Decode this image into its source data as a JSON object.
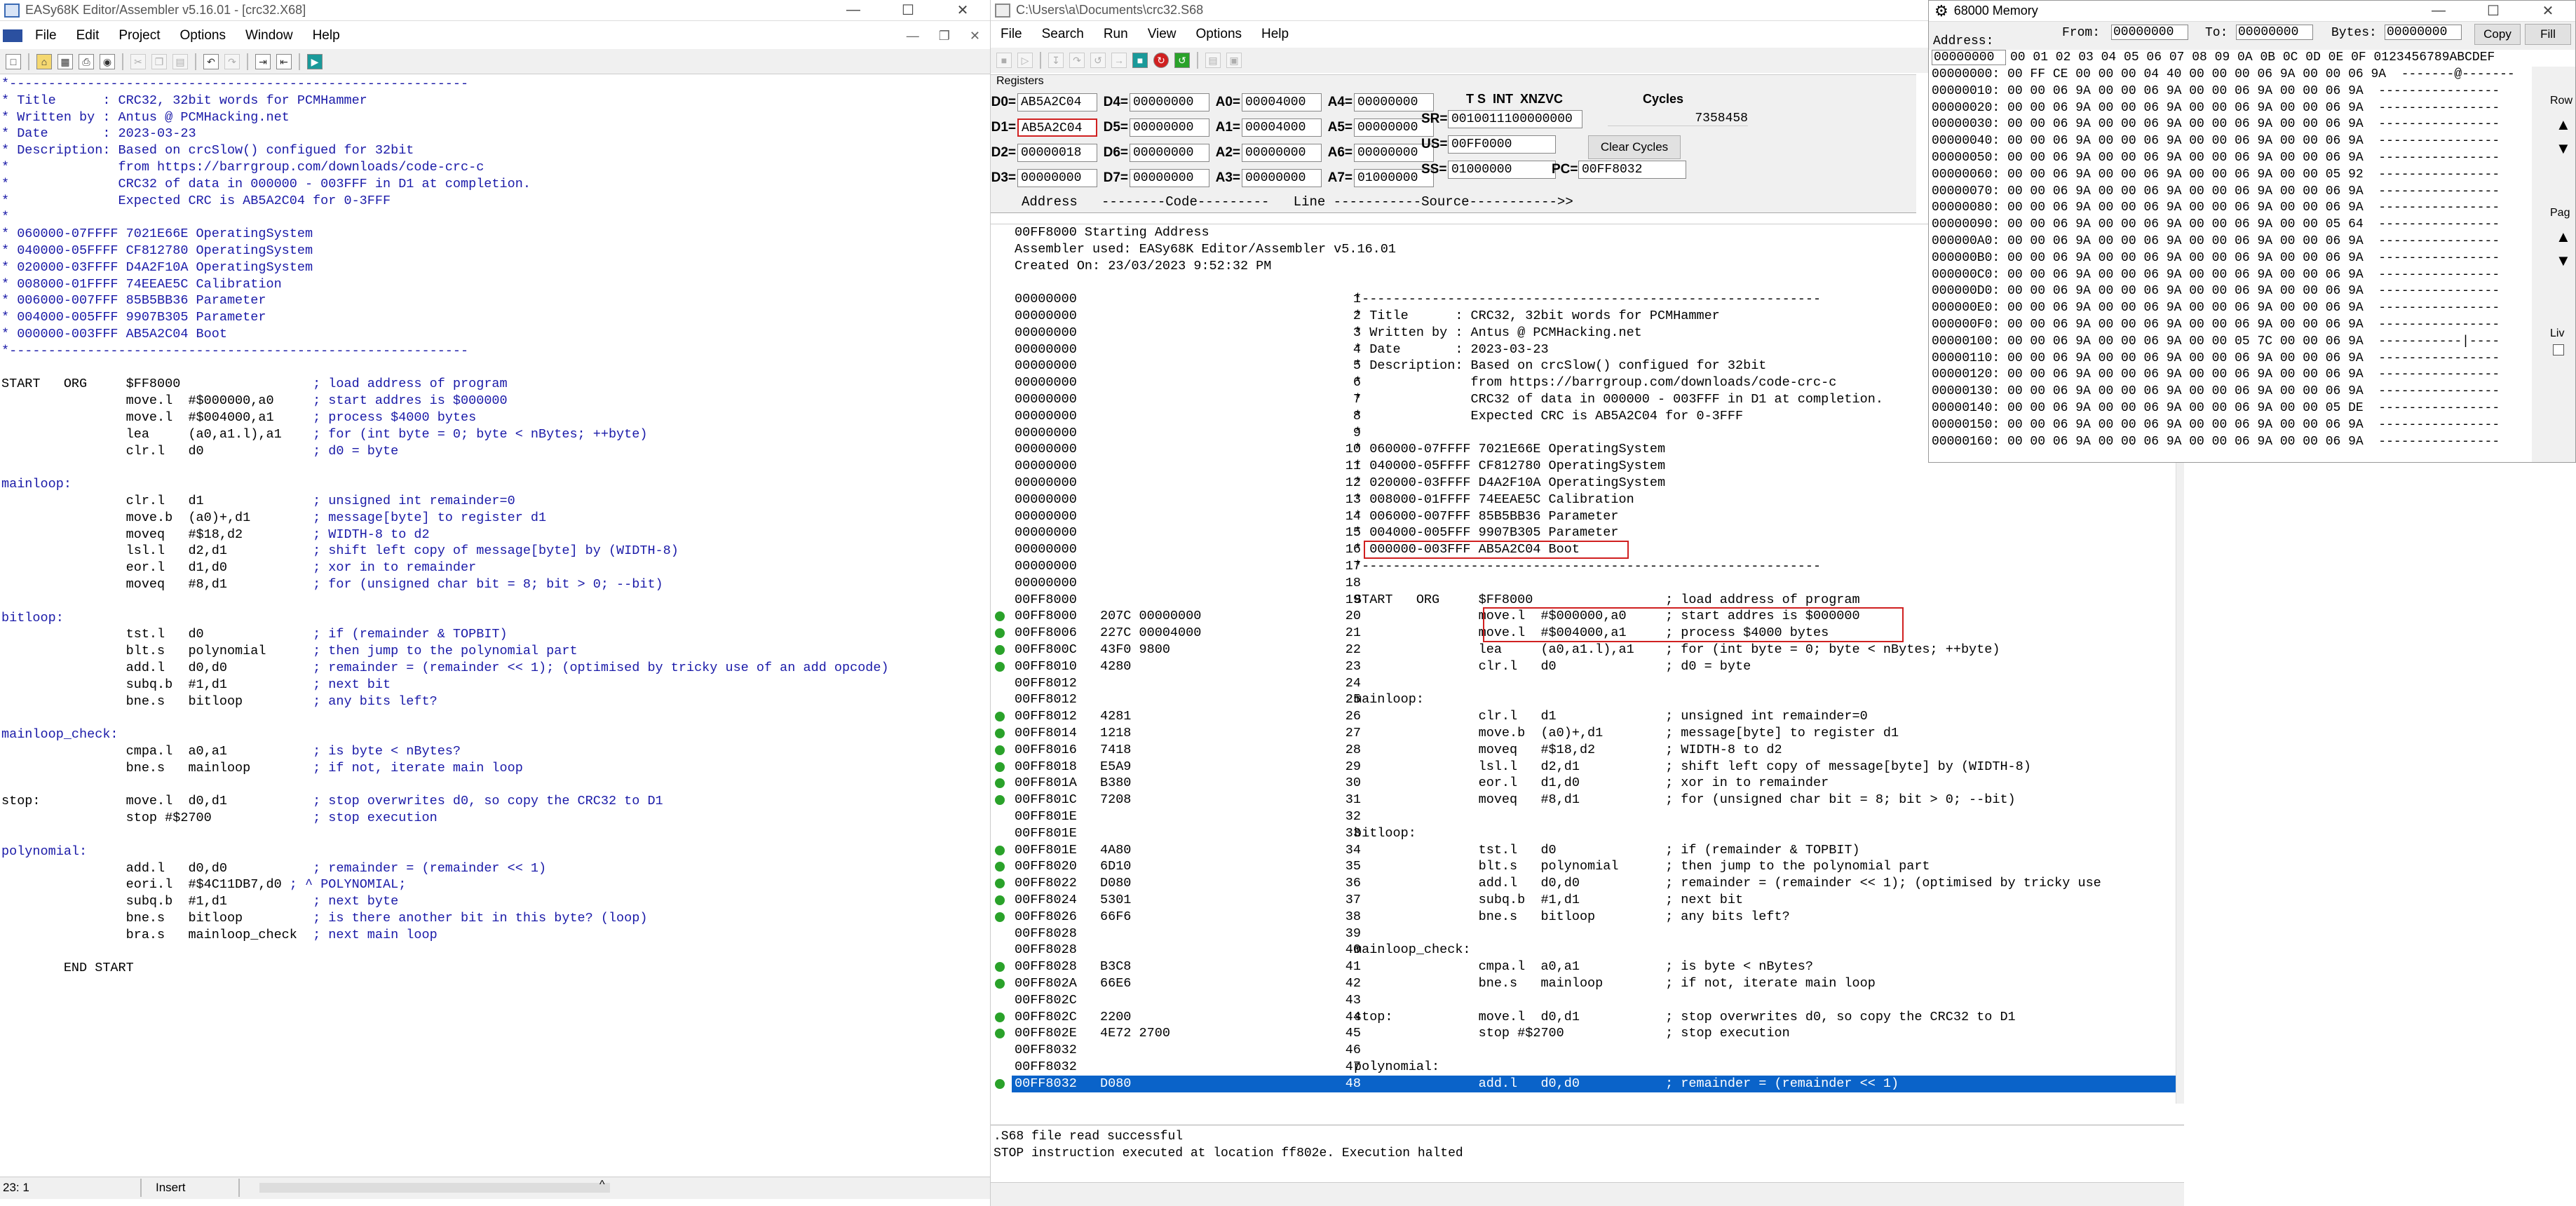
{
  "editor": {
    "title": "EASy68K Editor/Assembler v5.16.01 - [crc32.X68]",
    "menu": [
      "File",
      "Edit",
      "Project",
      "Options",
      "Window",
      "Help"
    ],
    "status": {
      "pos": "23: 1",
      "mode": "Insert"
    },
    "code": [
      {
        "t": "*-----------------------------------------------------------",
        "c": "blue"
      },
      {
        "t": "* Title      : CRC32, 32bit words for PCMHammer",
        "c": "blue"
      },
      {
        "t": "* Written by : Antus @ PCMHacking.net",
        "c": "blue"
      },
      {
        "t": "* Date       : 2023-03-23",
        "c": "blue"
      },
      {
        "t": "* Description: Based on crcSlow() configued for 32bit",
        "c": "blue"
      },
      {
        "t": "*              from https://barrgroup.com/downloads/code-crc-c",
        "c": "blue"
      },
      {
        "t": "*              CRC32 of data in 000000 - 003FFF in D1 at completion.",
        "c": "blue"
      },
      {
        "t": "*              Expected CRC is AB5A2C04 for 0-3FFF",
        "c": "blue"
      },
      {
        "t": "*",
        "c": "blue"
      },
      {
        "t": "* 060000-07FFFF 7021E66E OperatingSystem",
        "c": "blue"
      },
      {
        "t": "* 040000-05FFFF CF812780 OperatingSystem",
        "c": "blue"
      },
      {
        "t": "* 020000-03FFFF D4A2F10A OperatingSystem",
        "c": "blue"
      },
      {
        "t": "* 008000-01FFFF 74EEAE5C Calibration",
        "c": "blue"
      },
      {
        "t": "* 006000-007FFF 85B5BB36 Parameter",
        "c": "blue"
      },
      {
        "t": "* 004000-005FFF 9907B305 Parameter",
        "c": "blue"
      },
      {
        "t": "* 000000-003FFF AB5A2C04 Boot",
        "c": "blue"
      },
      {
        "t": "*-----------------------------------------------------------",
        "c": "blue"
      },
      {
        "t": "",
        "c": ""
      },
      {
        "t": "START   ORG     $FF8000                 ; load address of program",
        "c": "mix"
      },
      {
        "t": "                move.l  #$000000,a0     ; start addres is $000000",
        "c": "mix"
      },
      {
        "t": "                move.l  #$004000,a1     ; process $4000 bytes",
        "c": "mix"
      },
      {
        "t": "                lea     (a0,a1.l),a1    ; for (int byte = 0; byte < nBytes; ++byte)",
        "c": "mix"
      },
      {
        "t": "                clr.l   d0              ; d0 = byte",
        "c": "mix"
      },
      {
        "t": "",
        "c": ""
      },
      {
        "t": "mainloop:",
        "c": "blue"
      },
      {
        "t": "                clr.l   d1              ; unsigned int remainder=0",
        "c": "mix"
      },
      {
        "t": "                move.b  (a0)+,d1        ; message[byte] to register d1",
        "c": "mix"
      },
      {
        "t": "                moveq   #$18,d2         ; WIDTH-8 to d2",
        "c": "mix"
      },
      {
        "t": "                lsl.l   d2,d1           ; shift left copy of message[byte] by (WIDTH-8)",
        "c": "mix"
      },
      {
        "t": "                eor.l   d1,d0           ; xor in to remainder",
        "c": "mix"
      },
      {
        "t": "                moveq   #8,d1           ; for (unsigned char bit = 8; bit > 0; --bit)",
        "c": "mix"
      },
      {
        "t": "",
        "c": ""
      },
      {
        "t": "bitloop:",
        "c": "blue"
      },
      {
        "t": "                tst.l   d0              ; if (remainder & TOPBIT)",
        "c": "mix"
      },
      {
        "t": "                blt.s   polynomial      ; then jump to the polynomial part",
        "c": "mix"
      },
      {
        "t": "                add.l   d0,d0           ; remainder = (remainder << 1); (optimised by tricky use of an add opcode)",
        "c": "mix"
      },
      {
        "t": "                subq.b  #1,d1           ; next bit",
        "c": "mix"
      },
      {
        "t": "                bne.s   bitloop         ; any bits left?",
        "c": "mix"
      },
      {
        "t": "",
        "c": ""
      },
      {
        "t": "mainloop_check:",
        "c": "blue"
      },
      {
        "t": "                cmpa.l  a0,a1           ; is byte < nBytes?",
        "c": "mix"
      },
      {
        "t": "                bne.s   mainloop        ; if not, iterate main loop",
        "c": "mix"
      },
      {
        "t": "",
        "c": ""
      },
      {
        "t": "stop:           move.l  d0,d1           ; stop overwrites d0, so copy the CRC32 to D1",
        "c": "mix"
      },
      {
        "t": "                stop #$2700             ; stop execution",
        "c": "mix"
      },
      {
        "t": "",
        "c": ""
      },
      {
        "t": "polynomial:",
        "c": "blue"
      },
      {
        "t": "                add.l   d0,d0           ; remainder = (remainder << 1)",
        "c": "mix"
      },
      {
        "t": "                eori.l  #$4C11DB7,d0 ; ^ POLYNOMIAL;",
        "c": "mix"
      },
      {
        "t": "                subq.b  #1,d1           ; next byte",
        "c": "mix"
      },
      {
        "t": "                bne.s   bitloop         ; is there another bit in this byte? (loop)",
        "c": "mix"
      },
      {
        "t": "                bra.s   mainloop_check  ; next main loop",
        "c": "mix"
      },
      {
        "t": "",
        "c": ""
      },
      {
        "t": "        END START",
        "c": ""
      }
    ]
  },
  "sim": {
    "title": "C:\\Users\\a\\Documents\\crc32.S68",
    "menu": [
      "File",
      "Search",
      "Run",
      "View",
      "Options",
      "Help"
    ],
    "registers_label": "Registers",
    "registers": [
      {
        "n": "D0=",
        "v": "AB5A2C04",
        "hl": false
      },
      {
        "n": "D4=",
        "v": "00000000",
        "hl": false
      },
      {
        "n": "A0=",
        "v": "00004000",
        "hl": false
      },
      {
        "n": "A4=",
        "v": "00000000",
        "hl": false
      },
      {
        "n": "D1=",
        "v": "AB5A2C04",
        "hl": true
      },
      {
        "n": "D5=",
        "v": "00000000",
        "hl": false
      },
      {
        "n": "A1=",
        "v": "00004000",
        "hl": false
      },
      {
        "n": "A5=",
        "v": "00000000",
        "hl": false
      },
      {
        "n": "D2=",
        "v": "00000018",
        "hl": false
      },
      {
        "n": "D6=",
        "v": "00000000",
        "hl": false
      },
      {
        "n": "A2=",
        "v": "00000000",
        "hl": false
      },
      {
        "n": "A6=",
        "v": "00000000",
        "hl": false
      },
      {
        "n": "D3=",
        "v": "00000000",
        "hl": false
      },
      {
        "n": "D7=",
        "v": "00000000",
        "hl": false
      },
      {
        "n": "A3=",
        "v": "00000000",
        "hl": false
      },
      {
        "n": "A7=",
        "v": "01000000",
        "hl": false
      }
    ],
    "sr_header": "T S  INT  XNZVC",
    "sr": {
      "n": "SR=",
      "v": "0010011100000000"
    },
    "us": {
      "n": "US=",
      "v": "00FF0000"
    },
    "ss": {
      "n": "SS=",
      "v": "01000000"
    },
    "pc": {
      "n": "PC=",
      "v": "00FF8032"
    },
    "cycles_label": "Cycles",
    "cycles": "7358458",
    "clear_cycles": "Clear Cycles",
    "list_header": "Address   --------Code---------   Line -----------Source----------->>",
    "list_preamble": [
      "00FF8000 Starting Address",
      "Assembler used: EASy68K Editor/Assembler v5.16.01",
      "Created On: 23/03/2023 9:52:32 PM"
    ],
    "rows": [
      {
        "a": "00000000",
        "c": "",
        "n": "1",
        "s": "*-----------------------------------------------------------",
        "d": false
      },
      {
        "a": "00000000",
        "c": "",
        "n": "2",
        "s": "* Title      : CRC32, 32bit words for PCMHammer",
        "d": false
      },
      {
        "a": "00000000",
        "c": "",
        "n": "3",
        "s": "* Written by : Antus @ PCMHacking.net",
        "d": false
      },
      {
        "a": "00000000",
        "c": "",
        "n": "4",
        "s": "* Date       : 2023-03-23",
        "d": false
      },
      {
        "a": "00000000",
        "c": "",
        "n": "5",
        "s": "* Description: Based on crcSlow() configued for 32bit",
        "d": false
      },
      {
        "a": "00000000",
        "c": "",
        "n": "6",
        "s": "*              from https://barrgroup.com/downloads/code-crc-c",
        "d": false
      },
      {
        "a": "00000000",
        "c": "",
        "n": "7",
        "s": "*              CRC32 of data in 000000 - 003FFF in D1 at completion.",
        "d": false
      },
      {
        "a": "00000000",
        "c": "",
        "n": "8",
        "s": "*              Expected CRC is AB5A2C04 for 0-3FFF",
        "d": false
      },
      {
        "a": "00000000",
        "c": "",
        "n": "9",
        "s": "*",
        "d": false
      },
      {
        "a": "00000000",
        "c": "",
        "n": "10",
        "s": "* 060000-07FFFF 7021E66E OperatingSystem",
        "d": false
      },
      {
        "a": "00000000",
        "c": "",
        "n": "11",
        "s": "* 040000-05FFFF CF812780 OperatingSystem",
        "d": false
      },
      {
        "a": "00000000",
        "c": "",
        "n": "12",
        "s": "* 020000-03FFFF D4A2F10A OperatingSystem",
        "d": false
      },
      {
        "a": "00000000",
        "c": "",
        "n": "13",
        "s": "* 008000-01FFFF 74EEAE5C Calibration",
        "d": false
      },
      {
        "a": "00000000",
        "c": "",
        "n": "14",
        "s": "* 006000-007FFF 85B5BB36 Parameter",
        "d": false
      },
      {
        "a": "00000000",
        "c": "",
        "n": "15",
        "s": "* 004000-005FFF 9907B305 Parameter",
        "d": false
      },
      {
        "a": "00000000",
        "c": "",
        "n": "16",
        "s": "* 000000-003FFF AB5A2C04 Boot",
        "d": false
      },
      {
        "a": "00000000",
        "c": "",
        "n": "17",
        "s": "*-----------------------------------------------------------",
        "d": false
      },
      {
        "a": "00000000",
        "c": "",
        "n": "18",
        "s": "",
        "d": false
      },
      {
        "a": "00FF8000",
        "c": "",
        "n": "19",
        "s": "START   ORG     $FF8000                 ; load address of program",
        "d": false
      },
      {
        "a": "00FF8000",
        "c": "207C 00000000",
        "n": "20",
        "s": "                move.l  #$000000,a0     ; start addres is $000000",
        "d": true
      },
      {
        "a": "00FF8006",
        "c": "227C 00004000",
        "n": "21",
        "s": "                move.l  #$004000,a1     ; process $4000 bytes",
        "d": true
      },
      {
        "a": "00FF800C",
        "c": "43F0 9800",
        "n": "22",
        "s": "                lea     (a0,a1.l),a1    ; for (int byte = 0; byte < nBytes; ++byte)",
        "d": true
      },
      {
        "a": "00FF8010",
        "c": "4280",
        "n": "23",
        "s": "                clr.l   d0              ; d0 = byte",
        "d": true
      },
      {
        "a": "00FF8012",
        "c": "",
        "n": "24",
        "s": "",
        "d": false
      },
      {
        "a": "00FF8012",
        "c": "",
        "n": "25",
        "s": "mainloop:",
        "d": false
      },
      {
        "a": "00FF8012",
        "c": "4281",
        "n": "26",
        "s": "                clr.l   d1              ; unsigned int remainder=0",
        "d": true
      },
      {
        "a": "00FF8014",
        "c": "1218",
        "n": "27",
        "s": "                move.b  (a0)+,d1        ; message[byte] to register d1",
        "d": true
      },
      {
        "a": "00FF8016",
        "c": "7418",
        "n": "28",
        "s": "                moveq   #$18,d2         ; WIDTH-8 to d2",
        "d": true
      },
      {
        "a": "00FF8018",
        "c": "E5A9",
        "n": "29",
        "s": "                lsl.l   d2,d1           ; shift left copy of message[byte] by (WIDTH-8)",
        "d": true
      },
      {
        "a": "00FF801A",
        "c": "B380",
        "n": "30",
        "s": "                eor.l   d1,d0           ; xor in to remainder",
        "d": true
      },
      {
        "a": "00FF801C",
        "c": "7208",
        "n": "31",
        "s": "                moveq   #8,d1           ; for (unsigned char bit = 8; bit > 0; --bit)",
        "d": true
      },
      {
        "a": "00FF801E",
        "c": "",
        "n": "32",
        "s": "",
        "d": false
      },
      {
        "a": "00FF801E",
        "c": "",
        "n": "33",
        "s": "bitloop:",
        "d": false
      },
      {
        "a": "00FF801E",
        "c": "4A80",
        "n": "34",
        "s": "                tst.l   d0              ; if (remainder & TOPBIT)",
        "d": true
      },
      {
        "a": "00FF8020",
        "c": "6D10",
        "n": "35",
        "s": "                blt.s   polynomial      ; then jump to the polynomial part",
        "d": true
      },
      {
        "a": "00FF8022",
        "c": "D080",
        "n": "36",
        "s": "                add.l   d0,d0           ; remainder = (remainder << 1); (optimised by tricky use",
        "d": true
      },
      {
        "a": "00FF8024",
        "c": "5301",
        "n": "37",
        "s": "                subq.b  #1,d1           ; next bit",
        "d": true
      },
      {
        "a": "00FF8026",
        "c": "66F6",
        "n": "38",
        "s": "                bne.s   bitloop         ; any bits left?",
        "d": true
      },
      {
        "a": "00FF8028",
        "c": "",
        "n": "39",
        "s": "",
        "d": false
      },
      {
        "a": "00FF8028",
        "c": "",
        "n": "40",
        "s": "mainloop_check:",
        "d": false
      },
      {
        "a": "00FF8028",
        "c": "B3C8",
        "n": "41",
        "s": "                cmpa.l  a0,a1           ; is byte < nBytes?",
        "d": true
      },
      {
        "a": "00FF802A",
        "c": "66E6",
        "n": "42",
        "s": "                bne.s   mainloop        ; if not, iterate main loop",
        "d": true
      },
      {
        "a": "00FF802C",
        "c": "",
        "n": "43",
        "s": "",
        "d": false
      },
      {
        "a": "00FF802C",
        "c": "2200",
        "n": "44",
        "s": "stop:           move.l  d0,d1           ; stop overwrites d0, so copy the CRC32 to D1",
        "d": true
      },
      {
        "a": "00FF802E",
        "c": "4E72 2700",
        "n": "45",
        "s": "                stop #$2700             ; stop execution",
        "d": true
      },
      {
        "a": "00FF8032",
        "c": "",
        "n": "46",
        "s": "",
        "d": false
      },
      {
        "a": "00FF8032",
        "c": "",
        "n": "47",
        "s": "polynomial:",
        "d": false
      },
      {
        "a": "00FF8032",
        "c": "D080",
        "n": "48",
        "s": "                add.l   d0,d0           ; remainder = (remainder << 1)",
        "d": true
      }
    ],
    "messages": [
      ".S68 file read successful",
      "STOP instruction executed at location ff802e. Execution halted"
    ]
  },
  "memory": {
    "title": "68000 Memory",
    "address_label": "Address:",
    "address_value": "00000000",
    "from_label": "From:",
    "from_value": "00000000",
    "to_label": "To:",
    "to_value": "00000000",
    "bytes_label": "Bytes:",
    "bytes_value": "00000000",
    "copy_btn": "Copy",
    "fill_btn": "Fill",
    "side_labels": [
      "Row",
      "Pag",
      "Liv"
    ],
    "header": "00 01 02 03 04 05 06 07 08 09 0A 0B 0C 0D 0E 0F 0123456789ABCDEF",
    "rows": [
      "00000000: 00 FF CE 00 00 00 04 40 00 00 00 06 9A 00 00 06 9A  -------@-------",
      "00000010: 00 00 06 9A 00 00 06 9A 00 00 06 9A 00 00 06 9A  ----------------",
      "00000020: 00 00 06 9A 00 00 06 9A 00 00 06 9A 00 00 06 9A  ----------------",
      "00000030: 00 00 06 9A 00 00 06 9A 00 00 06 9A 00 00 06 9A  ----------------",
      "00000040: 00 00 06 9A 00 00 06 9A 00 00 06 9A 00 00 06 9A  ----------------",
      "00000050: 00 00 06 9A 00 00 06 9A 00 00 06 9A 00 00 06 9A  ----------------",
      "00000060: 00 00 06 9A 00 00 06 9A 00 00 06 9A 00 00 05 92  ----------------",
      "00000070: 00 00 06 9A 00 00 06 9A 00 00 06 9A 00 00 06 9A  ----------------",
      "00000080: 00 00 06 9A 00 00 06 9A 00 00 06 9A 00 00 06 9A  ----------------",
      "00000090: 00 00 06 9A 00 00 06 9A 00 00 06 9A 00 00 05 64  ----------------",
      "000000A0: 00 00 06 9A 00 00 06 9A 00 00 06 9A 00 00 06 9A  ----------------",
      "000000B0: 00 00 06 9A 00 00 06 9A 00 00 06 9A 00 00 06 9A  ----------------",
      "000000C0: 00 00 06 9A 00 00 06 9A 00 00 06 9A 00 00 06 9A  ----------------",
      "000000D0: 00 00 06 9A 00 00 06 9A 00 00 06 9A 00 00 06 9A  ----------------",
      "000000E0: 00 00 06 9A 00 00 06 9A 00 00 06 9A 00 00 06 9A  ----------------",
      "000000F0: 00 00 06 9A 00 00 06 9A 00 00 06 9A 00 00 06 9A  ----------------",
      "00000100: 00 00 06 9A 00 00 06 9A 00 00 05 7C 00 00 06 9A  -----------|----",
      "00000110: 00 00 06 9A 00 00 06 9A 00 00 06 9A 00 00 06 9A  ----------------",
      "00000120: 00 00 06 9A 00 00 06 9A 00 00 06 9A 00 00 06 9A  ----------------",
      "00000130: 00 00 06 9A 00 00 06 9A 00 00 06 9A 00 00 06 9A  ----------------",
      "00000140: 00 00 06 9A 00 00 06 9A 00 00 06 9A 00 00 05 DE  ----------------",
      "00000150: 00 00 06 9A 00 00 06 9A 00 00 06 9A 00 00 06 9A  ----------------",
      "00000160: 00 00 06 9A 00 00 06 9A 00 00 06 9A 00 00 06 9A  ----------------"
    ]
  }
}
